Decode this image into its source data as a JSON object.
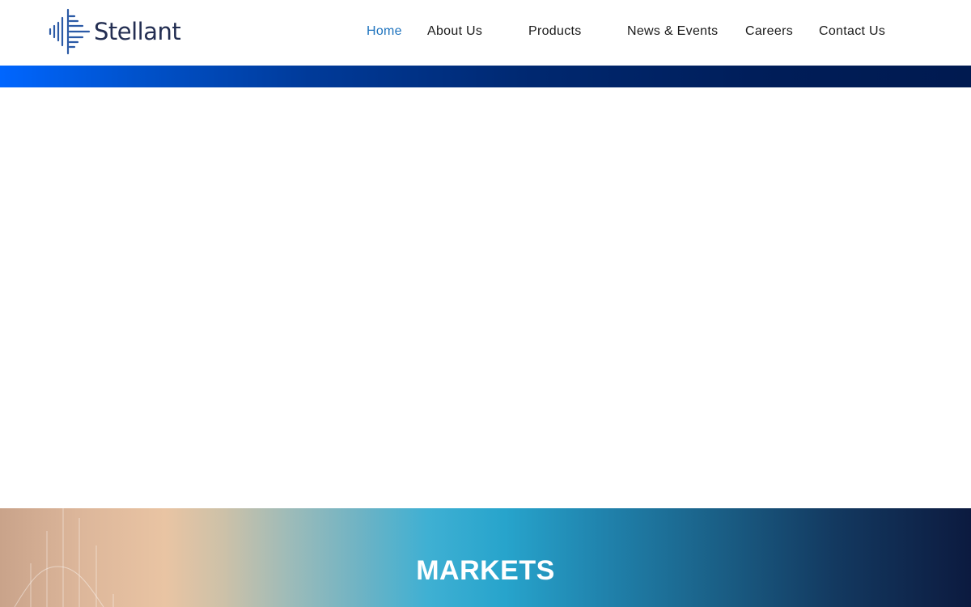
{
  "brand": {
    "name": "Stellant",
    "logo_icon": "waveform-mark-icon",
    "text_color": "#232e52",
    "mark_color": "#2b5aa6"
  },
  "nav": {
    "items": [
      {
        "label": "Home",
        "active": true
      },
      {
        "label": "About Us",
        "active": false
      },
      {
        "label": "Products",
        "active": false
      },
      {
        "label": "News & Events",
        "active": false
      },
      {
        "label": "Careers",
        "active": false
      },
      {
        "label": "Contact Us",
        "active": false
      }
    ],
    "active_color": "#1e73be",
    "text_color": "#1a1a1a"
  },
  "markets": {
    "title": "MARKETS"
  }
}
